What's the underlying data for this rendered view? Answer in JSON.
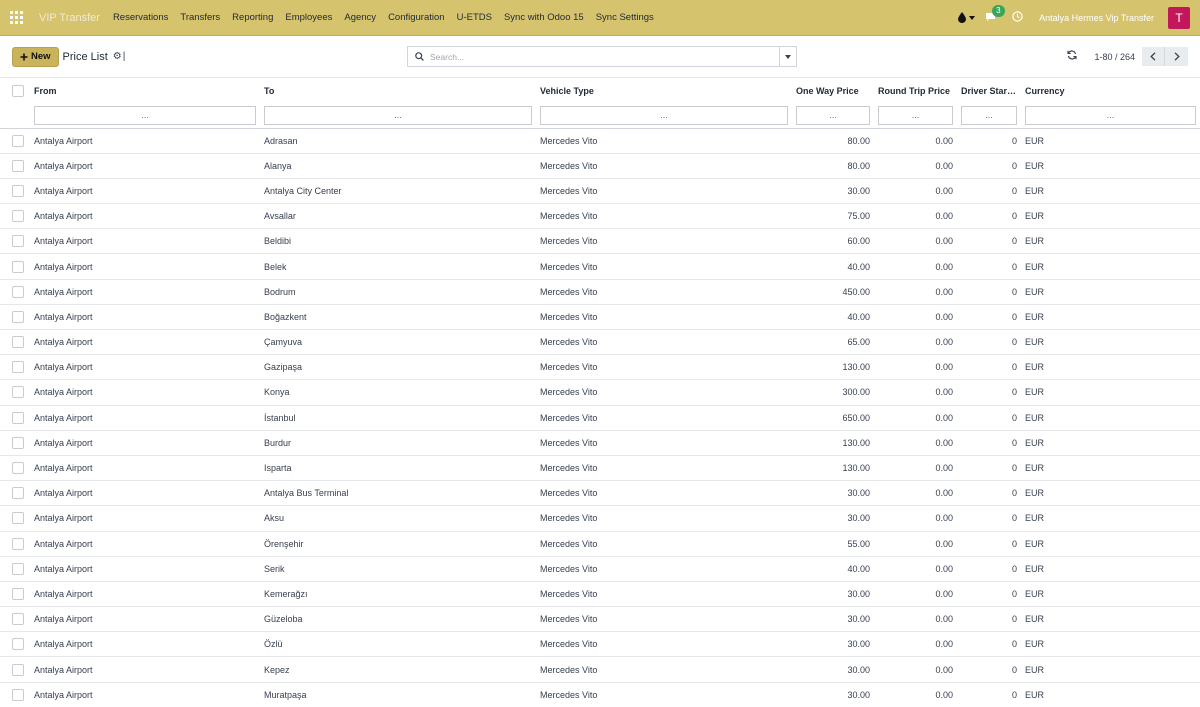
{
  "navbar": {
    "brand": "VIP Transfer",
    "menu": [
      "Reservations",
      "Transfers",
      "Reporting",
      "Employees",
      "Agency",
      "Configuration",
      "U-ETDS",
      "Sync with Odoo 15",
      "Sync Settings"
    ],
    "message_count": "3",
    "company": "Antalya Hermes Vip Transfer",
    "avatar_letter": "T"
  },
  "control": {
    "new_label": "New",
    "title": "Price List",
    "search_placeholder": "Search...",
    "pager": "1-80 / 264"
  },
  "columns": [
    "From",
    "To",
    "Vehicle Type",
    "One Way Price",
    "Round Trip Price",
    "Driver Start…",
    "Currency"
  ],
  "filter_placeholder": "...",
  "rows": [
    [
      "Antalya Airport",
      "Adrasan",
      "Mercedes Vito",
      "80.00",
      "0.00",
      "0",
      "EUR"
    ],
    [
      "Antalya Airport",
      "Alanya",
      "Mercedes Vito",
      "80.00",
      "0.00",
      "0",
      "EUR"
    ],
    [
      "Antalya Airport",
      "Antalya City Center",
      "Mercedes Vito",
      "30.00",
      "0.00",
      "0",
      "EUR"
    ],
    [
      "Antalya Airport",
      "Avsallar",
      "Mercedes Vito",
      "75.00",
      "0.00",
      "0",
      "EUR"
    ],
    [
      "Antalya Airport",
      "Beldibi",
      "Mercedes Vito",
      "60.00",
      "0.00",
      "0",
      "EUR"
    ],
    [
      "Antalya Airport",
      "Belek",
      "Mercedes Vito",
      "40.00",
      "0.00",
      "0",
      "EUR"
    ],
    [
      "Antalya Airport",
      "Bodrum",
      "Mercedes Vito",
      "450.00",
      "0.00",
      "0",
      "EUR"
    ],
    [
      "Antalya Airport",
      "Boğazkent",
      "Mercedes Vito",
      "40.00",
      "0.00",
      "0",
      "EUR"
    ],
    [
      "Antalya Airport",
      "Çamyuva",
      "Mercedes Vito",
      "65.00",
      "0.00",
      "0",
      "EUR"
    ],
    [
      "Antalya Airport",
      "Gazipaşa",
      "Mercedes Vito",
      "130.00",
      "0.00",
      "0",
      "EUR"
    ],
    [
      "Antalya Airport",
      "Konya",
      "Mercedes Vito",
      "300.00",
      "0.00",
      "0",
      "EUR"
    ],
    [
      "Antalya Airport",
      "İstanbul",
      "Mercedes Vito",
      "650.00",
      "0.00",
      "0",
      "EUR"
    ],
    [
      "Antalya Airport",
      "Burdur",
      "Mercedes Vito",
      "130.00",
      "0.00",
      "0",
      "EUR"
    ],
    [
      "Antalya Airport",
      "Isparta",
      "Mercedes Vito",
      "130.00",
      "0.00",
      "0",
      "EUR"
    ],
    [
      "Antalya Airport",
      "Antalya Bus Terminal",
      "Mercedes Vito",
      "30.00",
      "0.00",
      "0",
      "EUR"
    ],
    [
      "Antalya Airport",
      "Aksu",
      "Mercedes Vito",
      "30.00",
      "0.00",
      "0",
      "EUR"
    ],
    [
      "Antalya Airport",
      "Örenşehir",
      "Mercedes Vito",
      "55.00",
      "0.00",
      "0",
      "EUR"
    ],
    [
      "Antalya Airport",
      "Serik",
      "Mercedes Vito",
      "40.00",
      "0.00",
      "0",
      "EUR"
    ],
    [
      "Antalya Airport",
      "Kemerağzı",
      "Mercedes Vito",
      "30.00",
      "0.00",
      "0",
      "EUR"
    ],
    [
      "Antalya Airport",
      "Güzeloba",
      "Mercedes Vito",
      "30.00",
      "0.00",
      "0",
      "EUR"
    ],
    [
      "Antalya Airport",
      "Özlü",
      "Mercedes Vito",
      "30.00",
      "0.00",
      "0",
      "EUR"
    ],
    [
      "Antalya Airport",
      "Kepez",
      "Mercedes Vito",
      "30.00",
      "0.00",
      "0",
      "EUR"
    ],
    [
      "Antalya Airport",
      "Muratpaşa",
      "Mercedes Vito",
      "30.00",
      "0.00",
      "0",
      "EUR"
    ]
  ]
}
